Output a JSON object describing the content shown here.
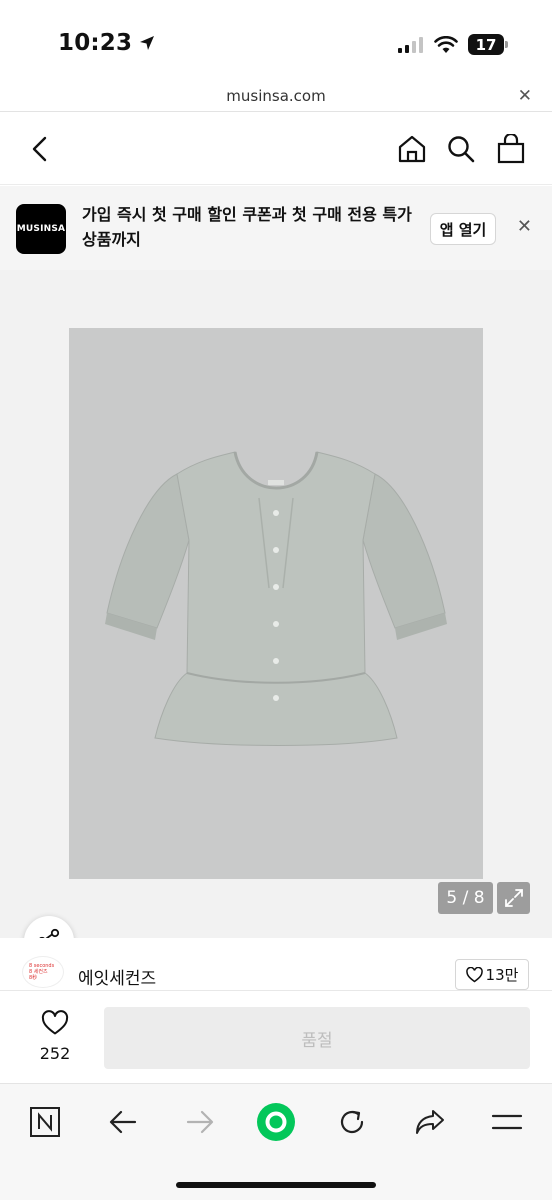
{
  "status_bar": {
    "time": "10:23",
    "battery": "17"
  },
  "browser": {
    "url": "musinsa.com",
    "close_icon": "close-icon"
  },
  "header": {
    "icons": [
      "chevron-left-icon",
      "home-icon",
      "search-icon",
      "bag-icon"
    ]
  },
  "app_banner": {
    "logo_text": "MUSINSA",
    "message": "가입 즉시 첫 구매 할인 쿠폰과 첫 구매 전용 특가 상품까지",
    "open_app_label": "앱 열기"
  },
  "gallery": {
    "page_indicator": "5 / 8"
  },
  "brand": {
    "name": "에잇세컨즈",
    "like_count": "13만",
    "logo_lines": [
      "8 seconds",
      "8 세컨즈",
      "8秒"
    ]
  },
  "purchase": {
    "wish_count": "252",
    "button_label": "품절"
  },
  "browser_toolbar": {
    "icons": [
      "naver-icon",
      "back-arrow-icon",
      "forward-arrow-icon",
      "green-home-icon",
      "reload-icon",
      "share-icon",
      "menu-icon"
    ]
  },
  "colors": {
    "accent_green": "#03c75a",
    "photo_bg": "#c9caca",
    "garment": "#b7bdb8"
  }
}
